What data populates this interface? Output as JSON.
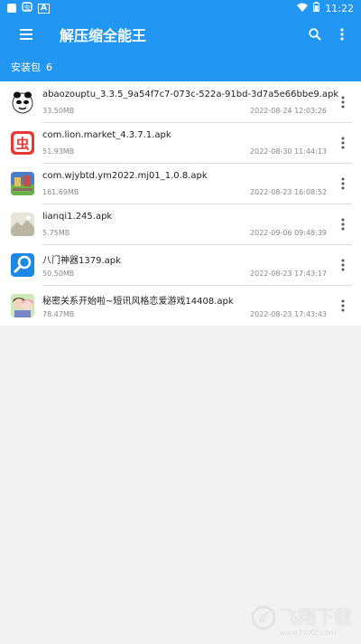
{
  "status_bar": {
    "time": "11:22",
    "left_icons": [
      "notification-square-icon",
      "bug-app-icon",
      "a-badge-icon"
    ],
    "right_icons": [
      "wifi-icon",
      "battery-icon"
    ]
  },
  "app_bar": {
    "title": "解压缩全能王",
    "menu_icon": "menu-icon",
    "search_icon": "search-icon",
    "more_icon": "more-vert-icon"
  },
  "section": {
    "label": "安装包",
    "count": "6"
  },
  "files": [
    {
      "name": "abaozouptu_3.3.5_9a54f7c7-073c-522a-91bd-3d7a5e66bbe9.apk",
      "size": "33.50MB",
      "date": "2022-08-24 12:03:26",
      "icon": "panda-face-icon"
    },
    {
      "name": "com.lion.market_4.3.7.1.apk",
      "size": "51.93MB",
      "date": "2022-08-30 11:44:13",
      "icon": "bug-chong-icon"
    },
    {
      "name": "com.wjybtd.ym2022.mj01_1.0.8.apk",
      "size": "161.69MB",
      "date": "2022-08-23 16:08:52",
      "icon": "game-app-icon"
    },
    {
      "name": "lianqi1.245.apk",
      "size": "5.75MB",
      "date": "2022-09-06 09:48:39",
      "icon": "landscape-app-icon"
    },
    {
      "name": "八门神器1379.apk",
      "size": "50.50MB",
      "date": "2022-08-23 17:43:17",
      "icon": "magnifier-app-icon"
    },
    {
      "name": "秘密关系开始啦~短讯风格恋爱游戏14408.apk",
      "size": "78.47MB",
      "date": "2022-08-23 17:43:43",
      "icon": "anime-girls-icon"
    }
  ],
  "watermark": {
    "text": "飞翔下载",
    "sub": "www.FXXZ.com"
  },
  "colors": {
    "primary": "#2196f3",
    "background": "#f2f2f2"
  }
}
